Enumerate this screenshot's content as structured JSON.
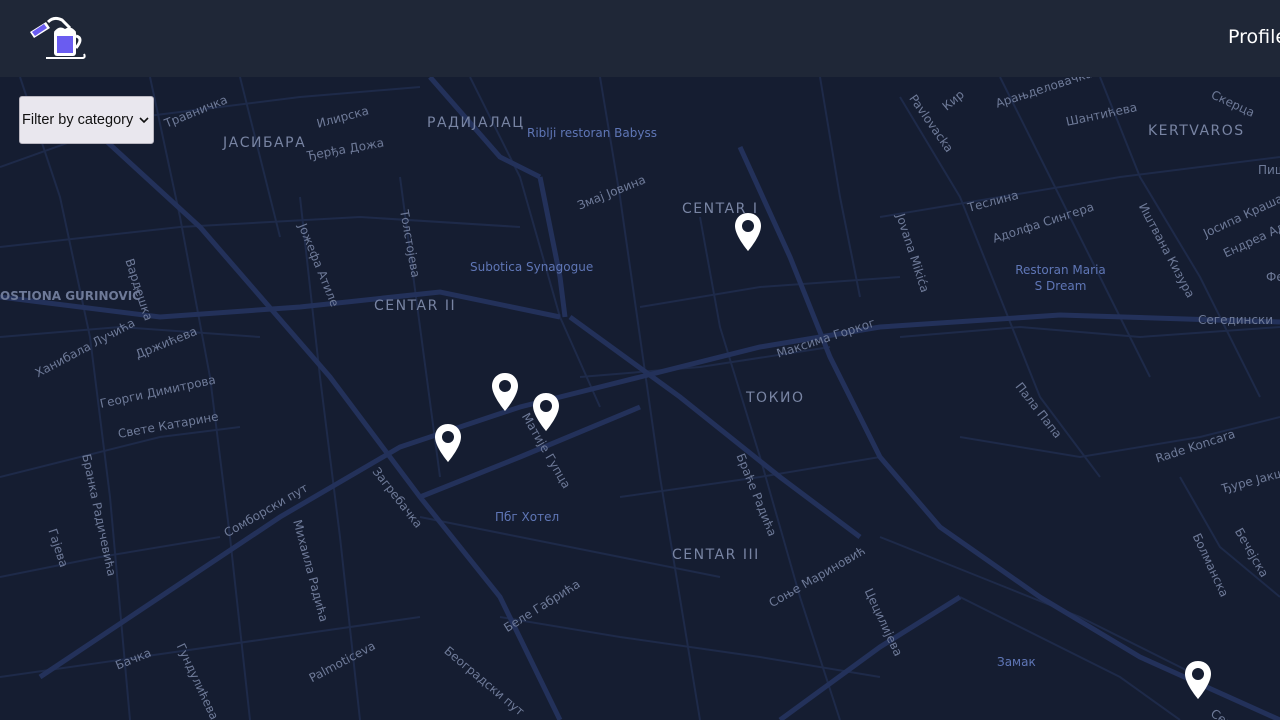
{
  "header": {
    "logo_icon": "beer-mug-logo-icon",
    "profile_label": "Profile"
  },
  "filter": {
    "label": "Filter by category",
    "icon": "chevron-down-icon"
  },
  "map": {
    "street_labels": [
      "Травничка",
      "Илирска",
      "Ђерђа Дожа",
      "Змај Јовина",
      "Јожефа Атиле",
      "Толстојева",
      "Вардешка",
      "Ханибала Лучића",
      "Држићева",
      "Георги Димитрова",
      "Свете Катарине",
      "Бранка Радичевића",
      "Гајева",
      "Сомборски пут",
      "Загребачка",
      "Михаила Радића",
      "Palmoticeva",
      "Бачка",
      "Гундулићева",
      "Беле Габрића",
      "Београдски пут",
      "Матије Гупца",
      "Максима Горког",
      "Браће Радића",
      "Соње Мариновић",
      "Цецилијева",
      "Jovana Mikića",
      "Pavlovacka",
      "Кир",
      "Арањделовачка",
      "Шантићева",
      "Скерца",
      "Теслина",
      "Адолфа Сингера",
      "Иштвана Кизура",
      "Јосипа Краша",
      "Ендреа Ади",
      "Пала Папа",
      "Rade Koncara",
      "Ђуре Јакш",
      "Бечејска",
      "Болманска",
      "Сегедински",
      "Фе",
      "Пиш",
      "Сен"
    ],
    "area_labels": [
      "ЈАСИБАРА",
      "РАДИЈАЛАЦ",
      "CENTAR I",
      "CENTAR II",
      "ТОКИО",
      "CENTAR III",
      "KERTVAROS",
      "OSTIONA GURINOVIĆ"
    ],
    "poi_labels": [
      "Riblji restoran Babyss",
      "Subotica Synagogue",
      "Restoran Maria S Dream",
      "Пбг Хотел",
      "Замак"
    ],
    "pins": [
      {
        "name": "location-pin-centar-1"
      },
      {
        "name": "location-pin-a"
      },
      {
        "name": "location-pin-b"
      },
      {
        "name": "location-pin-c"
      },
      {
        "name": "location-pin-southeast"
      }
    ],
    "colors": {
      "background": "#151d31",
      "roads": "#1e2a49",
      "major_roads": "#23315a",
      "labels": "#6e7a98"
    }
  }
}
